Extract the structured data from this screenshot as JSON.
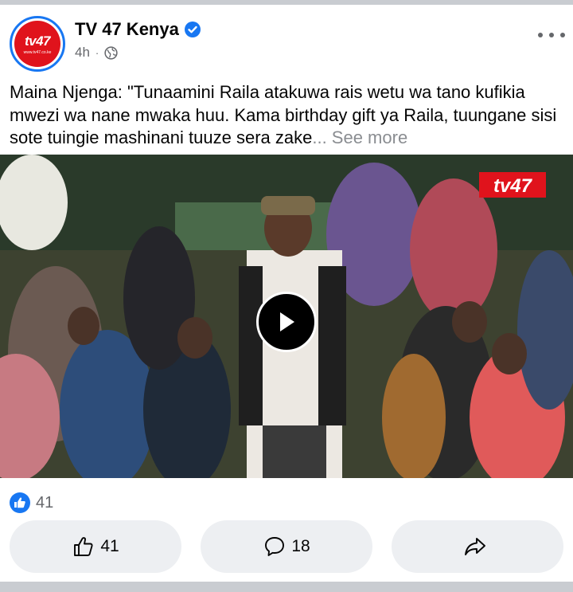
{
  "post": {
    "page_name": "TV 47 Kenya",
    "time": "4h",
    "separator": "·",
    "text": "Maina Njenga: \"Tunaamini Raila atakuwa rais wetu wa tano kufikia mwezi wa nane mwaka huu. Kama birthday gift ya Raila, tuungane sisi sote tuingie mashinani tuuze sera zake",
    "see_more": "... See more",
    "avatar_logo_text": "tv47",
    "avatar_url_text": "www.tv47.co.ke",
    "video_logo_text": "tv47"
  },
  "reactions": {
    "count": "41",
    "icon": "like-icon"
  },
  "actions": {
    "like_count": "41",
    "comment_count": "18"
  },
  "colors": {
    "facebook_blue": "#1877f2",
    "tv47_red": "#e0131c",
    "button_bg": "#edeff2",
    "secondary_text": "#65676b"
  }
}
